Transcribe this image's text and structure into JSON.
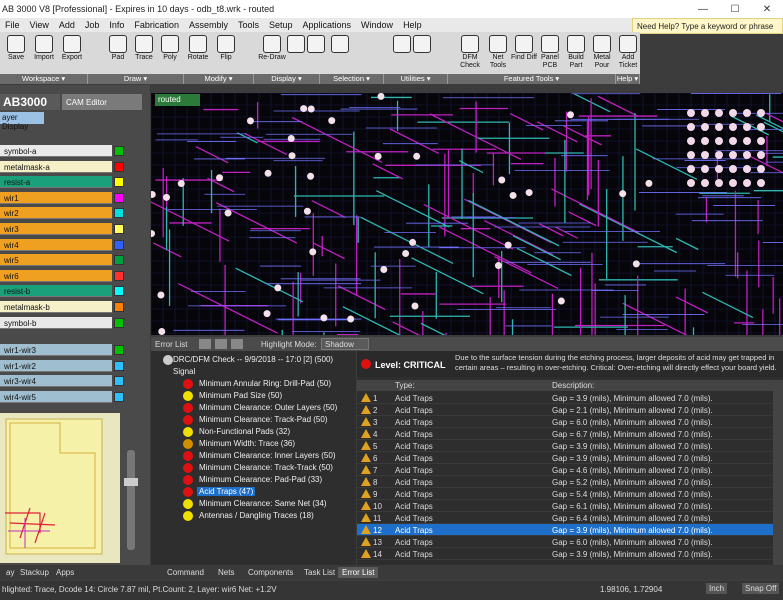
{
  "window": {
    "title": "AB 3000 V8 [Professional] - Expires in 10 days - odb_t8.wrk - routed",
    "minimize": "—",
    "maximize": "☐",
    "close": "✕"
  },
  "menu": [
    "File",
    "View",
    "Add",
    "Job",
    "Info",
    "Fabrication",
    "Assembly",
    "Tools",
    "Setup",
    "Applications",
    "Window",
    "Help"
  ],
  "help_box": "Need Help? Type a keyword or phrase",
  "ribbon": {
    "buttons": [
      {
        "label": "Save",
        "icon": "save-icon"
      },
      {
        "label": "Import",
        "icon": "import-icon"
      },
      {
        "label": "Export",
        "icon": "export-icon"
      },
      {
        "label": "Pad",
        "icon": "pad-icon"
      },
      {
        "label": "Trace",
        "icon": "trace-icon"
      },
      {
        "label": "Poly",
        "icon": "poly-icon"
      },
      {
        "label": "Rotate",
        "icon": "rotate-icon"
      },
      {
        "label": "Flip",
        "icon": "flip-icon"
      },
      {
        "label": "Re-Draw",
        "icon": "redraw-icon"
      },
      {
        "label": "",
        "icon": "zoom-in-icon"
      },
      {
        "label": "",
        "icon": "zoom-out-icon"
      },
      {
        "label": "",
        "icon": "select-icon"
      },
      {
        "label": "",
        "icon": "pan-icon"
      },
      {
        "label": "",
        "icon": "grid-icon"
      },
      {
        "label": "DFM Check",
        "icon": "dfm-check-icon"
      },
      {
        "label": "Net Tools",
        "icon": "net-tools-icon"
      },
      {
        "label": "Find Diff",
        "icon": "find-diff-icon"
      },
      {
        "label": "Panel PCB",
        "icon": "panel-pcb-icon"
      },
      {
        "label": "Build Part",
        "icon": "build-part-icon"
      },
      {
        "label": "Metal Pour",
        "icon": "metal-pour-icon"
      },
      {
        "label": "Add Ticket",
        "icon": "add-ticket-icon"
      }
    ],
    "groups": [
      "Workspace ▾",
      "Draw ▾",
      "Modify ▾",
      "Display ▾",
      "Selection ▾",
      "Utilities ▾",
      "Featured Tools ▾",
      "Help ▾"
    ]
  },
  "left": {
    "logo": "AB3000",
    "cam_tab": "CAM Editor",
    "layer_display": "ayer Display",
    "layers": [
      {
        "name": "symbol-a",
        "bg": "#e9e9e9",
        "swatch": "#00c000"
      },
      {
        "name": "metalmask-a",
        "bg": "#f5f0c8",
        "swatch": "#ff0000"
      },
      {
        "name": "resist-a",
        "bg": "#1aa07a",
        "swatch": "#ffff00"
      },
      {
        "name": "wir1",
        "bg": "#f0a020",
        "swatch": "#ff00ff"
      },
      {
        "name": "wir2",
        "bg": "#f0a020",
        "swatch": "#00e0e0"
      },
      {
        "name": "wir3",
        "bg": "#f0a020",
        "swatch": "#ffff60"
      },
      {
        "name": "wir4",
        "bg": "#f0a020",
        "swatch": "#3060ff"
      },
      {
        "name": "wir5",
        "bg": "#f0a020",
        "swatch": "#00a040"
      },
      {
        "name": "wir6",
        "bg": "#f0a020",
        "swatch": "#ff3030"
      },
      {
        "name": "resist-b",
        "bg": "#1aa07a",
        "swatch": "#00ffff"
      },
      {
        "name": "metalmask-b",
        "bg": "#f5f0c8",
        "swatch": "#ff8000"
      },
      {
        "name": "symbol-b",
        "bg": "#e9e9e9",
        "swatch": "#00c000"
      },
      {
        "name": "wir1-wir3",
        "bg": "#9fbfd0",
        "swatch": "#00c000"
      },
      {
        "name": "wir1-wir2",
        "bg": "#9fbfd0",
        "swatch": "#30c0ff"
      },
      {
        "name": "wir3-wir4",
        "bg": "#9fbfd0",
        "swatch": "#30c0ff"
      },
      {
        "name": "wir4-wir5",
        "bg": "#9fbfd0",
        "swatch": "#30c0ff"
      }
    ]
  },
  "canvas": {
    "tab": "routed"
  },
  "errorbar": {
    "title": "Error List",
    "highlight_label": "Highlight Mode:",
    "highlight_value": "Shadow"
  },
  "tree": {
    "root": "DRC/DFM Check -- 9/9/2018 -- 17:0 [2] (500)",
    "group": "Signal",
    "items": [
      {
        "label": "Minimum Annular Ring: Drill-Pad (50)",
        "color": "#e01010"
      },
      {
        "label": "Minimum Pad Size (50)",
        "color": "#f0e000"
      },
      {
        "label": "Minimum Clearance: Outer Layers (50)",
        "color": "#e01010"
      },
      {
        "label": "Minimum Clearance: Track-Pad (50)",
        "color": "#e01010"
      },
      {
        "label": "Non-Functional Pads (32)",
        "color": "#f0e000"
      },
      {
        "label": "Minimum Width: Trace (36)",
        "color": "#d09000"
      },
      {
        "label": "Minimum Clearance: Inner Layers (50)",
        "color": "#e01010"
      },
      {
        "label": "Minimum Clearance: Track-Track (50)",
        "color": "#e01010"
      },
      {
        "label": "Minimum Clearance: Pad-Pad (33)",
        "color": "#e01010"
      },
      {
        "label": "Acid Traps (47)",
        "color": "#e01010"
      },
      {
        "label": "Minimum Clearance: Same Net (34)",
        "color": "#f0e000"
      },
      {
        "label": "Antennas / Dangling Traces (18)",
        "color": "#f0e000"
      }
    ]
  },
  "details": {
    "level": "Level: CRITICAL",
    "desc": "Due to the surface tension during the etching process, larger deposits of acid may get trapped in certain areas – resulting in over-etching. Critical: Over-etching will directly effect your board yield.",
    "col_type": "Type:",
    "col_desc": "Description:",
    "rows": [
      {
        "n": "1",
        "type": "Acid Traps",
        "desc": "Gap = 3.9 (mils), Minimum allowed 7.0 (mils)."
      },
      {
        "n": "2",
        "type": "Acid Traps",
        "desc": "Gap = 2.1 (mils), Minimum allowed 7.0 (mils)."
      },
      {
        "n": "3",
        "type": "Acid Traps",
        "desc": "Gap = 6.0 (mils), Minimum allowed 7.0 (mils)."
      },
      {
        "n": "4",
        "type": "Acid Traps",
        "desc": "Gap = 6.7 (mils), Minimum allowed 7.0 (mils)."
      },
      {
        "n": "5",
        "type": "Acid Traps",
        "desc": "Gap = 3.9 (mils), Minimum allowed 7.0 (mils)."
      },
      {
        "n": "6",
        "type": "Acid Traps",
        "desc": "Gap = 3.9 (mils), Minimum allowed 7.0 (mils)."
      },
      {
        "n": "7",
        "type": "Acid Traps",
        "desc": "Gap = 4.6 (mils), Minimum allowed 7.0 (mils)."
      },
      {
        "n": "8",
        "type": "Acid Traps",
        "desc": "Gap = 5.2 (mils), Minimum allowed 7.0 (mils)."
      },
      {
        "n": "9",
        "type": "Acid Traps",
        "desc": "Gap = 5.4 (mils), Minimum allowed 7.0 (mils)."
      },
      {
        "n": "10",
        "type": "Acid Traps",
        "desc": "Gap = 6.1 (mils), Minimum allowed 7.0 (mils)."
      },
      {
        "n": "11",
        "type": "Acid Traps",
        "desc": "Gap = 6.4 (mils), Minimum allowed 7.0 (mils)."
      },
      {
        "n": "12",
        "type": "Acid Traps",
        "desc": "Gap = 3.9 (mils), Minimum allowed 7.0 (mils)."
      },
      {
        "n": "13",
        "type": "Acid Traps",
        "desc": "Gap = 6.0 (mils), Minimum allowed 7.0 (mils)."
      },
      {
        "n": "14",
        "type": "Acid Traps",
        "desc": "Gap = 3.9 (mils), Minimum allowed 7.0 (mils)."
      }
    ]
  },
  "bottom_tabs": [
    "ay",
    "Stackup",
    "Apps",
    "Command",
    "Nets",
    "Components",
    "Task List",
    "Error List"
  ],
  "status": {
    "left": "hlighted:  Trace, Dcode 14: Circle 7.87 mil, Pt.Count: 2, Layer: wir6  Net: +1.2V",
    "coords": "1.98106, 1.72904",
    "unit": "Inch",
    "snap": "Snap Off"
  }
}
